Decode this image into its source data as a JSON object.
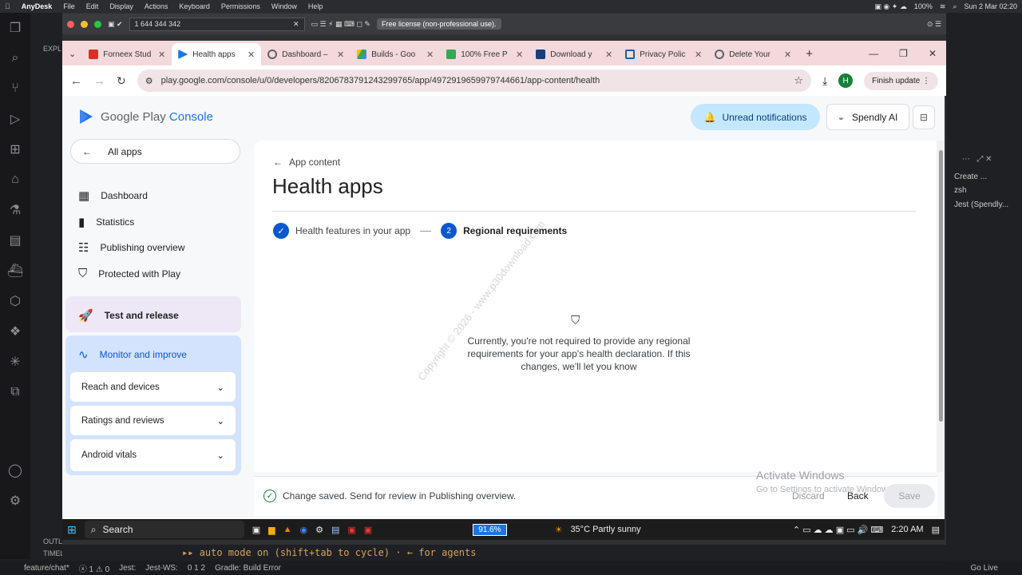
{
  "mac": {
    "app": "AnyDesk",
    "menus": [
      "File",
      "Edit",
      "Display",
      "Actions",
      "Keyboard",
      "Permissions",
      "Window",
      "Help"
    ],
    "battery": "100%",
    "clock": "Sun 2 Mar 02:20"
  },
  "anydesk": {
    "id": "1 644 344 342",
    "license": "Free license (non-professional use)."
  },
  "tabs": [
    {
      "label": "Forneex Stud",
      "color": "#d93025",
      "active": false
    },
    {
      "label": "Health apps",
      "color": "#1a73e8",
      "active": true
    },
    {
      "label": "Dashboard –",
      "color": "#5f6368",
      "active": false
    },
    {
      "label": "Builds - Goo",
      "color": "#188038",
      "active": false
    },
    {
      "label": "100% Free P",
      "color": "#34a853",
      "active": false
    },
    {
      "label": "Download y",
      "color": "#1a3d7c",
      "active": false
    },
    {
      "label": "Privacy Polic",
      "color": "#1a5fb4",
      "active": false
    },
    {
      "label": "Delete Your",
      "color": "#5f6368",
      "active": false
    }
  ],
  "address": "play.google.com/console/u/0/developers/8206783791243299765/app/4972919659979744661/app-content/health",
  "avatar": "H",
  "finish_update": "Finish update",
  "brand": {
    "google": "Google Play",
    "console": "Console"
  },
  "all_apps": "All apps",
  "nav": {
    "dashboard": "Dashboard",
    "statistics": "Statistics",
    "publishing": "Publishing overview",
    "protected": "Protected with Play",
    "test_release": "Test and release",
    "monitor": "Monitor and improve",
    "reach": "Reach and devices",
    "ratings": "Ratings and reviews",
    "vitals": "Android vitals"
  },
  "header": {
    "unread": "Unread notifications",
    "app_name": "Spendly AI"
  },
  "breadcrumb": "App content",
  "title": "Health apps",
  "steps": {
    "step1": "Health features in your app",
    "step2_num": "2",
    "step2": "Regional requirements"
  },
  "message": "Currently, you're not required to provide any regional requirements for your app's health declaration. If this changes, we'll let you know",
  "watermark": "Copyright © 2026 - www.p30download.com",
  "savebar": {
    "status": "Change saved. Send for review in Publishing overview.",
    "discard": "Discard",
    "back": "Back",
    "save": "Save"
  },
  "activate": {
    "title": "Activate Windows",
    "sub": "Go to Settings to activate Windows."
  },
  "taskbar": {
    "search": "Search",
    "zoom": "91.6%",
    "weather": "35°C  Partly sunny",
    "time": "2:20 AM"
  },
  "vscode": {
    "right_items": [
      "Create ...",
      "zsh",
      "Jest (Spendly..."
    ],
    "outline": "OUTLINE",
    "timeline": "TIMELINE",
    "terminal": "auto mode on (shift+tab to cycle) · ← for agents",
    "branch": "feature/chat*",
    "errors": "1",
    "warnings": "0",
    "jest": "Jest:",
    "jestws": "Jest-WS:",
    "ws_counts": "0  1  2",
    "gradle": "Gradle: Build Error",
    "golive": "Go Live",
    "explorer": "EXPL"
  }
}
